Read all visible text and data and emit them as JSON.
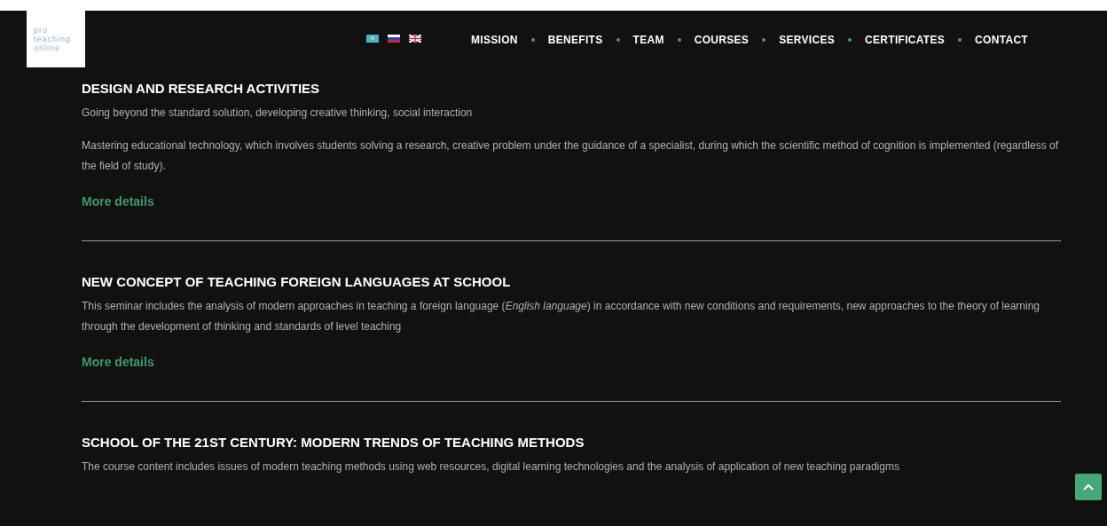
{
  "logo": {
    "lines": [
      "pro",
      "teaching",
      "online"
    ]
  },
  "languages": [
    {
      "kind": "kz"
    },
    {
      "kind": "ru"
    },
    {
      "kind": "en"
    }
  ],
  "nav": [
    "MISSION",
    "BENEFITS",
    "TEAM",
    "COURSES",
    "SERVICES",
    "CERTIFICATES",
    "CONTACT"
  ],
  "courses": [
    {
      "title": "DESIGN AND RESEARCH ACTIVITIES",
      "paragraphs": [
        "Going beyond the standard solution, developing creative thinking, social interaction",
        "Mastering educational technology, which involves students solving a research, creative problem under the guidance of a specialist, during which the scientific method of cognition is implemented (regardless of the field of study)."
      ],
      "link": "More details"
    },
    {
      "title": "NEW CONCEPT OF TEACHING FOREIGN LANGUAGES AT SCHOOL",
      "paragraphs": [
        "This seminar includes the analysis of modern approaches in teaching a foreign language (*English language*) in accordance with new conditions and requirements, new approaches to the theory of learning through the development of thinking and standards of level teaching"
      ],
      "link": "More details"
    },
    {
      "title": "SCHOOL OF THE 21ST CENTURY: MODERN TRENDS OF TEACHING METHODS",
      "paragraphs": [
        "The course content includes issues of modern teaching methods using web resources, digital learning technologies and the analysis of  application of new teaching paradigms"
      ]
    }
  ]
}
